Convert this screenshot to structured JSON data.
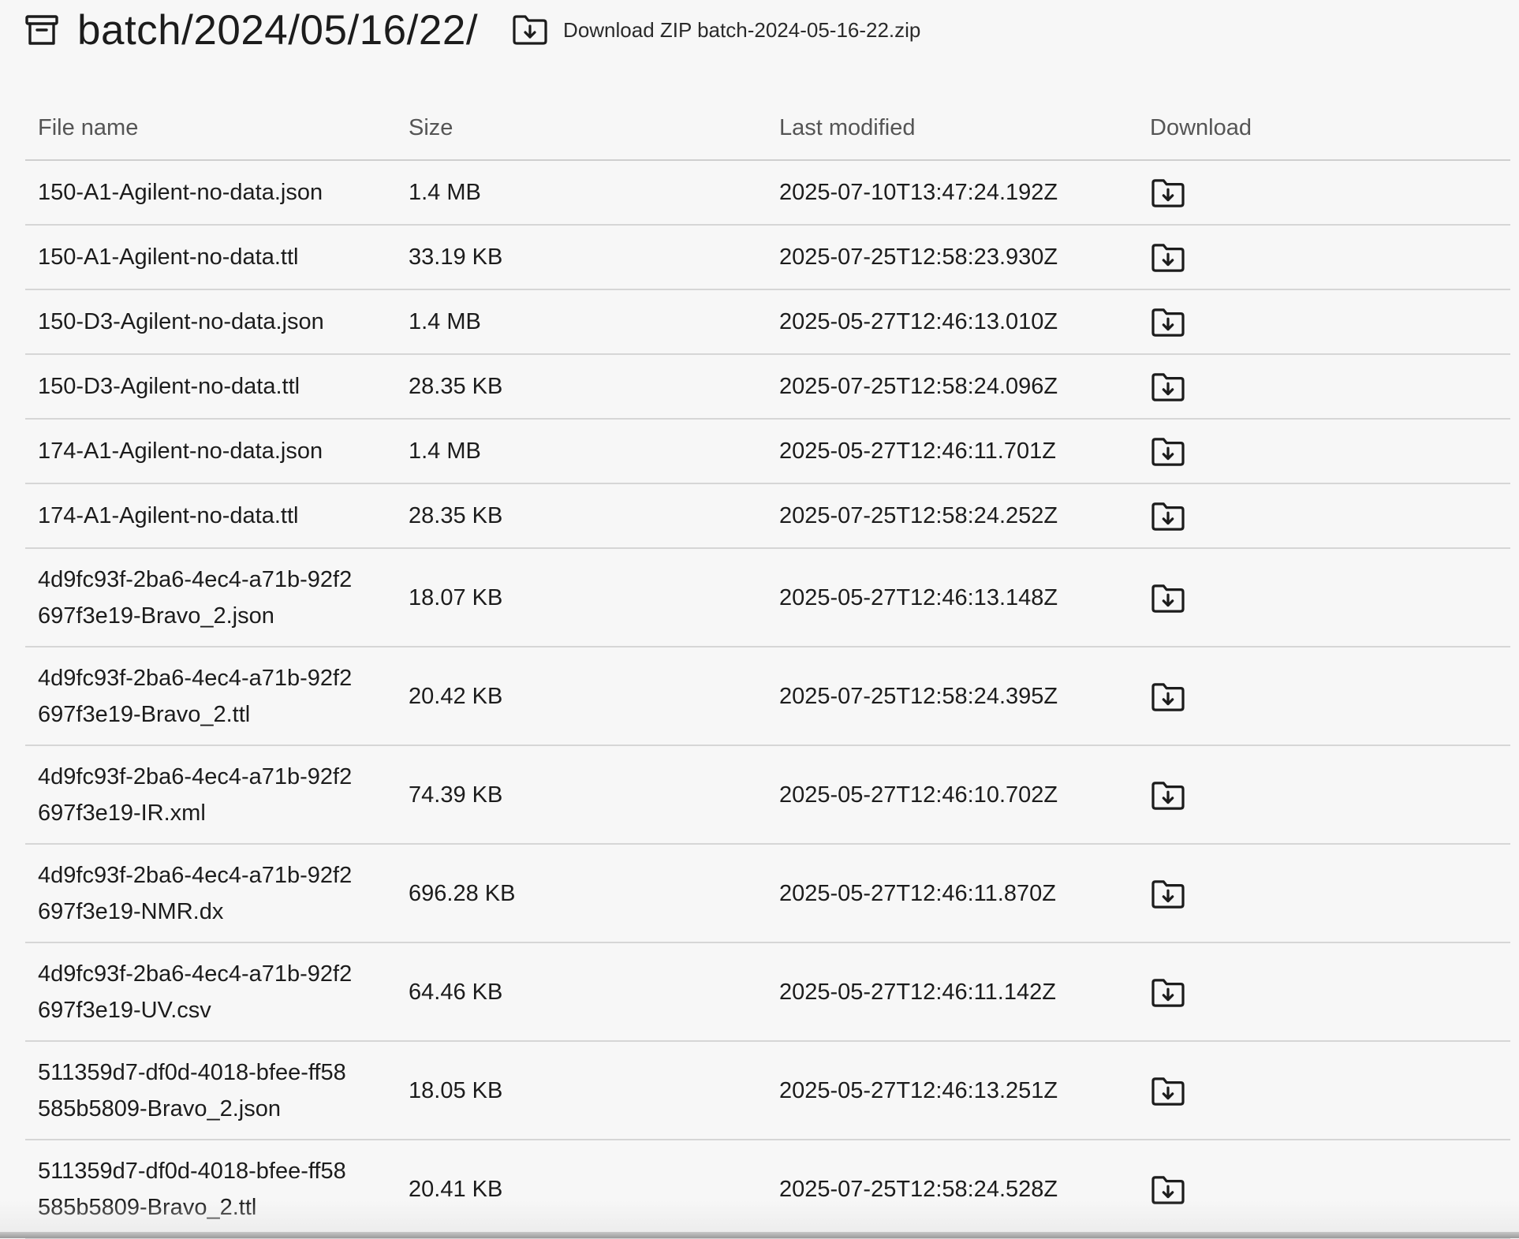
{
  "header": {
    "title": "batch/2024/05/16/22/",
    "archive_icon": "archive-icon",
    "zip_icon": "folder-download-icon",
    "zip_label": "Download ZIP batch-2024-05-16-22.zip"
  },
  "table": {
    "columns": {
      "name": "File name",
      "size": "Size",
      "modified": "Last modified",
      "download": "Download"
    },
    "download_icon": "folder-download-icon",
    "rows": [
      {
        "name": "150-A1-Agilent-no-data.json",
        "size": "1.4 MB",
        "modified": "2025-07-10T13:47:24.192Z"
      },
      {
        "name": "150-A1-Agilent-no-data.ttl",
        "size": "33.19 KB",
        "modified": "2025-07-25T12:58:23.930Z"
      },
      {
        "name": "150-D3-Agilent-no-data.json",
        "size": "1.4 MB",
        "modified": "2025-05-27T12:46:13.010Z"
      },
      {
        "name": "150-D3-Agilent-no-data.ttl",
        "size": "28.35 KB",
        "modified": "2025-07-25T12:58:24.096Z"
      },
      {
        "name": "174-A1-Agilent-no-data.json",
        "size": "1.4 MB",
        "modified": "2025-05-27T12:46:11.701Z"
      },
      {
        "name": "174-A1-Agilent-no-data.ttl",
        "size": "28.35 KB",
        "modified": "2025-07-25T12:58:24.252Z"
      },
      {
        "name": "4d9fc93f-2ba6-4ec4-a71b-92f2697f3e19-Bravo_2.json",
        "size": "18.07 KB",
        "modified": "2025-05-27T12:46:13.148Z"
      },
      {
        "name": "4d9fc93f-2ba6-4ec4-a71b-92f2697f3e19-Bravo_2.ttl",
        "size": "20.42 KB",
        "modified": "2025-07-25T12:58:24.395Z"
      },
      {
        "name": "4d9fc93f-2ba6-4ec4-a71b-92f2697f3e19-IR.xml",
        "size": "74.39 KB",
        "modified": "2025-05-27T12:46:10.702Z"
      },
      {
        "name": "4d9fc93f-2ba6-4ec4-a71b-92f2697f3e19-NMR.dx",
        "size": "696.28 KB",
        "modified": "2025-05-27T12:46:11.870Z"
      },
      {
        "name": "4d9fc93f-2ba6-4ec4-a71b-92f2697f3e19-UV.csv",
        "size": "64.46 KB",
        "modified": "2025-05-27T12:46:11.142Z"
      },
      {
        "name": "511359d7-df0d-4018-bfee-ff58585b5809-Bravo_2.json",
        "size": "18.05 KB",
        "modified": "2025-05-27T12:46:13.251Z"
      },
      {
        "name": "511359d7-df0d-4018-bfee-ff58585b5809-Bravo_2.ttl",
        "size": "20.41 KB",
        "modified": "2025-07-25T12:58:24.528Z"
      }
    ]
  }
}
